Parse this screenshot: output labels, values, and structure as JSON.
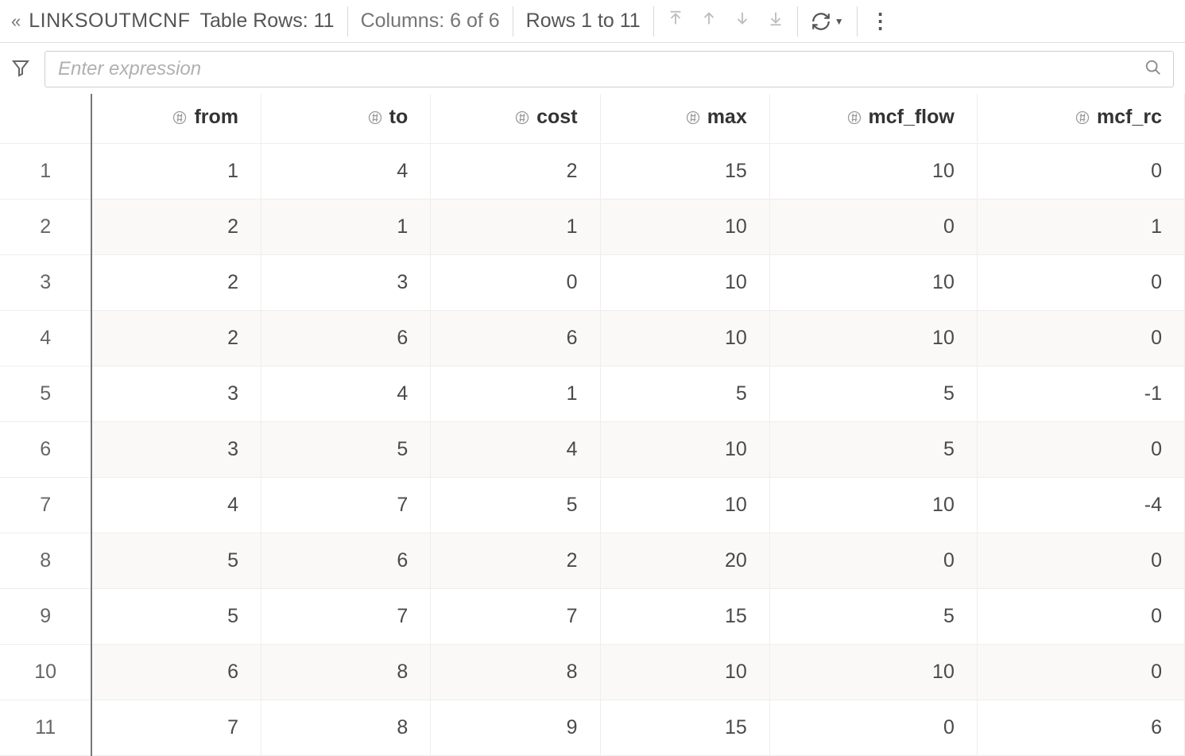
{
  "toolbar": {
    "title": "LINKSOUTMCNF",
    "rows_label": "Table Rows: 11",
    "columns_label": "Columns: 6 of 6",
    "range_label": "Rows 1 to 11"
  },
  "filter": {
    "placeholder": "Enter expression",
    "value": ""
  },
  "table": {
    "columns": [
      "from",
      "to",
      "cost",
      "max",
      "mcf_flow",
      "mcf_rc"
    ],
    "rows": [
      {
        "n": "1",
        "from": "1",
        "to": "4",
        "cost": "2",
        "max": "15",
        "mcf_flow": "10",
        "mcf_rc": "0"
      },
      {
        "n": "2",
        "from": "2",
        "to": "1",
        "cost": "1",
        "max": "10",
        "mcf_flow": "0",
        "mcf_rc": "1"
      },
      {
        "n": "3",
        "from": "2",
        "to": "3",
        "cost": "0",
        "max": "10",
        "mcf_flow": "10",
        "mcf_rc": "0"
      },
      {
        "n": "4",
        "from": "2",
        "to": "6",
        "cost": "6",
        "max": "10",
        "mcf_flow": "10",
        "mcf_rc": "0"
      },
      {
        "n": "5",
        "from": "3",
        "to": "4",
        "cost": "1",
        "max": "5",
        "mcf_flow": "5",
        "mcf_rc": "-1"
      },
      {
        "n": "6",
        "from": "3",
        "to": "5",
        "cost": "4",
        "max": "10",
        "mcf_flow": "5",
        "mcf_rc": "0"
      },
      {
        "n": "7",
        "from": "4",
        "to": "7",
        "cost": "5",
        "max": "10",
        "mcf_flow": "10",
        "mcf_rc": "-4"
      },
      {
        "n": "8",
        "from": "5",
        "to": "6",
        "cost": "2",
        "max": "20",
        "mcf_flow": "0",
        "mcf_rc": "0"
      },
      {
        "n": "9",
        "from": "5",
        "to": "7",
        "cost": "7",
        "max": "15",
        "mcf_flow": "5",
        "mcf_rc": "0"
      },
      {
        "n": "10",
        "from": "6",
        "to": "8",
        "cost": "8",
        "max": "10",
        "mcf_flow": "10",
        "mcf_rc": "0"
      },
      {
        "n": "11",
        "from": "7",
        "to": "8",
        "cost": "9",
        "max": "15",
        "mcf_flow": "0",
        "mcf_rc": "6"
      }
    ]
  },
  "chart_data": {
    "type": "table",
    "title": "LINKSOUTMCNF",
    "columns": [
      "from",
      "to",
      "cost",
      "max",
      "mcf_flow",
      "mcf_rc"
    ],
    "data": [
      [
        1,
        4,
        2,
        15,
        10,
        0
      ],
      [
        2,
        1,
        1,
        10,
        0,
        1
      ],
      [
        2,
        3,
        0,
        10,
        10,
        0
      ],
      [
        2,
        6,
        6,
        10,
        10,
        0
      ],
      [
        3,
        4,
        1,
        5,
        5,
        -1
      ],
      [
        3,
        5,
        4,
        10,
        5,
        0
      ],
      [
        4,
        7,
        5,
        10,
        10,
        -4
      ],
      [
        5,
        6,
        2,
        20,
        0,
        0
      ],
      [
        5,
        7,
        7,
        15,
        5,
        0
      ],
      [
        6,
        8,
        8,
        10,
        10,
        0
      ],
      [
        7,
        8,
        9,
        15,
        0,
        6
      ]
    ]
  }
}
